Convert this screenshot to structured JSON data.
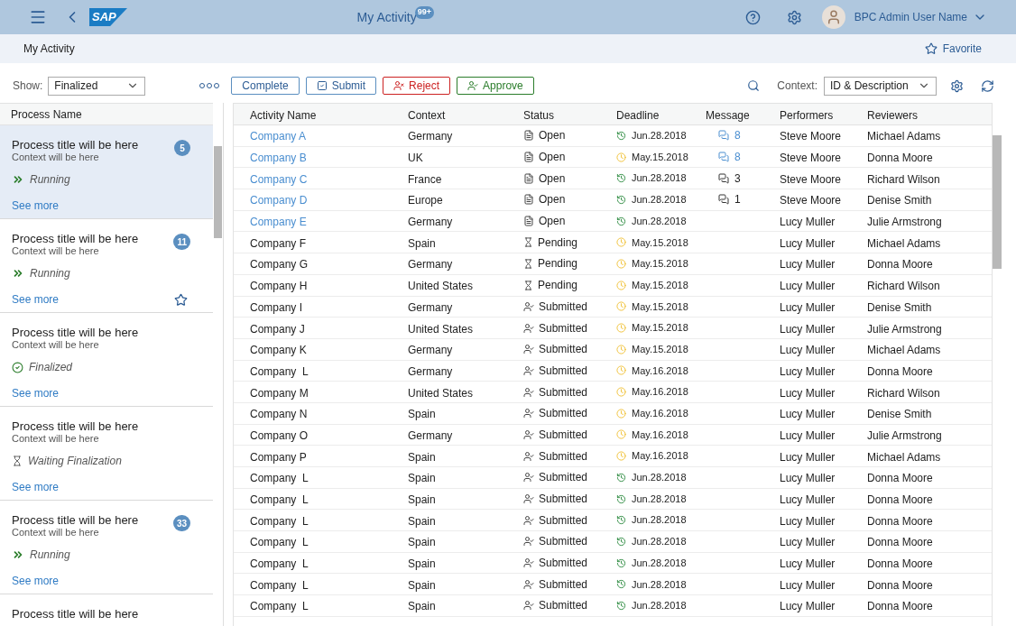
{
  "shell": {
    "logo": "SAP",
    "title": "My Activity",
    "badge": "99+",
    "user": "BPC Admin User Name"
  },
  "subheader": {
    "title": "My Activity",
    "favorite": "Favorite"
  },
  "toolbar": {
    "show_label": "Show:",
    "show_value": "Finalized",
    "buttons": [
      {
        "label": "Complete",
        "kind": "plain"
      },
      {
        "label": "Submit",
        "kind": "submit"
      },
      {
        "label": "Reject",
        "kind": "reject"
      },
      {
        "label": "Approve",
        "kind": "approve"
      }
    ],
    "context_label": "Context:",
    "context_value": "ID & Description"
  },
  "process_list": {
    "header": "Process Name",
    "items": [
      {
        "title": "Process title will be here",
        "context": "Context will be here",
        "status": "Running",
        "kind": "running",
        "count": "5",
        "selected": true,
        "favorite": false,
        "link": "See more"
      },
      {
        "title": "Process title will be here",
        "context": "Context will be here",
        "status": "Running",
        "kind": "running",
        "count": "11",
        "selected": false,
        "favorite": true,
        "link": "See more"
      },
      {
        "title": "Process title will be here",
        "context": "Context will be here",
        "status": "Finalized",
        "kind": "finalized",
        "selected": false,
        "favorite": false,
        "link": "See more"
      },
      {
        "title": "Process title will be here",
        "context": "Context will be here",
        "status": "Waiting Finalization",
        "kind": "waiting",
        "selected": false,
        "favorite": false,
        "link": "See more"
      },
      {
        "title": "Process title will be here",
        "context": "Context will be here",
        "status": "Running",
        "kind": "running",
        "count": "33",
        "selected": false,
        "favorite": false,
        "link": "See more"
      },
      {
        "title": "Process title will be here",
        "selected": false
      }
    ]
  },
  "table": {
    "columns": [
      "Activity Name",
      "Context",
      "Status",
      "Deadline",
      "Message",
      "Performers",
      "Reviewers"
    ],
    "rows": [
      {
        "name": "Company A",
        "link": true,
        "context": "Germany",
        "status": {
          "label": "Open",
          "kind": "open"
        },
        "deadline": {
          "date": "Jun.28.2018",
          "kind": "ontime"
        },
        "message": {
          "count": "8",
          "unread": true
        },
        "performer": "Steve Moore",
        "reviewer": "Michael Adams"
      },
      {
        "name": "Company B",
        "link": true,
        "context": "UK",
        "status": {
          "label": "Open",
          "kind": "open"
        },
        "deadline": {
          "date": "May.15.2018",
          "kind": "due"
        },
        "message": {
          "count": "8",
          "unread": true
        },
        "performer": "Steve Moore",
        "reviewer": "Donna Moore"
      },
      {
        "name": "Company C",
        "link": true,
        "context": "France",
        "status": {
          "label": "Open",
          "kind": "open"
        },
        "deadline": {
          "date": "Jun.28.2018",
          "kind": "ontime"
        },
        "message": {
          "count": "3",
          "unread": false
        },
        "performer": "Steve Moore",
        "reviewer": "Richard Wilson"
      },
      {
        "name": "Company D",
        "link": true,
        "context": "Europe",
        "status": {
          "label": "Open",
          "kind": "open"
        },
        "deadline": {
          "date": "Jun.28.2018",
          "kind": "ontime"
        },
        "message": {
          "count": "1",
          "unread": false
        },
        "performer": "Steve Moore",
        "reviewer": "Denise Smith"
      },
      {
        "name": "Company E",
        "link": true,
        "context": "Germany",
        "status": {
          "label": "Open",
          "kind": "open"
        },
        "deadline": {
          "date": "Jun.28.2018",
          "kind": "ontime"
        },
        "performer": "Lucy Muller",
        "reviewer": "Julie Armstrong"
      },
      {
        "name": "Company F",
        "link": false,
        "context": "Spain",
        "status": {
          "label": "Pending",
          "kind": "pending"
        },
        "deadline": {
          "date": "May.15.2018",
          "kind": "due"
        },
        "performer": "Lucy Muller",
        "reviewer": "Michael Adams"
      },
      {
        "name": "Company G",
        "link": false,
        "context": "Germany",
        "status": {
          "label": "Pending",
          "kind": "pending"
        },
        "deadline": {
          "date": "May.15.2018",
          "kind": "due"
        },
        "performer": "Lucy Muller",
        "reviewer": "Donna Moore"
      },
      {
        "name": "Company H",
        "link": false,
        "context": "United States",
        "status": {
          "label": "Pending",
          "kind": "pending"
        },
        "deadline": {
          "date": "May.15.2018",
          "kind": "due"
        },
        "performer": "Lucy Muller",
        "reviewer": "Richard Wilson"
      },
      {
        "name": "Company I",
        "link": false,
        "context": "Germany",
        "status": {
          "label": "Submitted",
          "kind": "submitted"
        },
        "deadline": {
          "date": "May.15.2018",
          "kind": "due"
        },
        "performer": "Lucy Muller",
        "reviewer": "Denise Smith"
      },
      {
        "name": "Company J",
        "link": false,
        "context": "United States",
        "status": {
          "label": "Submitted",
          "kind": "submitted"
        },
        "deadline": {
          "date": "May.15.2018",
          "kind": "due"
        },
        "performer": "Lucy Muller",
        "reviewer": "Julie Armstrong"
      },
      {
        "name": "Company K",
        "link": false,
        "context": "Germany",
        "status": {
          "label": "Submitted",
          "kind": "submitted"
        },
        "deadline": {
          "date": "May.15.2018",
          "kind": "due"
        },
        "performer": "Lucy Muller",
        "reviewer": "Michael Adams"
      },
      {
        "name": "Company  L",
        "link": false,
        "context": "Germany",
        "status": {
          "label": "Submitted",
          "kind": "submitted"
        },
        "deadline": {
          "date": "May.16.2018",
          "kind": "due"
        },
        "performer": "Lucy Muller",
        "reviewer": "Donna Moore"
      },
      {
        "name": "Company M",
        "link": false,
        "context": "United States",
        "status": {
          "label": "Submitted",
          "kind": "submitted"
        },
        "deadline": {
          "date": "May.16.2018",
          "kind": "due"
        },
        "performer": "Lucy Muller",
        "reviewer": "Richard Wilson"
      },
      {
        "name": "Company N",
        "link": false,
        "context": "Spain",
        "status": {
          "label": "Submitted",
          "kind": "submitted"
        },
        "deadline": {
          "date": "May.16.2018",
          "kind": "due"
        },
        "performer": "Lucy Muller",
        "reviewer": "Denise Smith"
      },
      {
        "name": "Company O",
        "link": false,
        "context": "Germany",
        "status": {
          "label": "Submitted",
          "kind": "submitted"
        },
        "deadline": {
          "date": "May.16.2018",
          "kind": "due"
        },
        "performer": "Lucy Muller",
        "reviewer": "Julie Armstrong"
      },
      {
        "name": "Company P",
        "link": false,
        "context": "Spain",
        "status": {
          "label": "Submitted",
          "kind": "submitted"
        },
        "deadline": {
          "date": "May.16.2018",
          "kind": "due"
        },
        "performer": "Lucy Muller",
        "reviewer": "Michael Adams"
      },
      {
        "name": "Company  L",
        "link": false,
        "context": "Spain",
        "status": {
          "label": "Submitted",
          "kind": "submitted"
        },
        "deadline": {
          "date": "Jun.28.2018",
          "kind": "ontime"
        },
        "performer": "Lucy Muller",
        "reviewer": "Donna Moore"
      },
      {
        "name": "Company  L",
        "link": false,
        "context": "Spain",
        "status": {
          "label": "Submitted",
          "kind": "submitted"
        },
        "deadline": {
          "date": "Jun.28.2018",
          "kind": "ontime"
        },
        "performer": "Lucy Muller",
        "reviewer": "Donna Moore"
      },
      {
        "name": "Company  L",
        "link": false,
        "context": "Spain",
        "status": {
          "label": "Submitted",
          "kind": "submitted"
        },
        "deadline": {
          "date": "Jun.28.2018",
          "kind": "ontime"
        },
        "performer": "Lucy Muller",
        "reviewer": "Donna Moore"
      },
      {
        "name": "Company  L",
        "link": false,
        "context": "Spain",
        "status": {
          "label": "Submitted",
          "kind": "submitted"
        },
        "deadline": {
          "date": "Jun.28.2018",
          "kind": "ontime"
        },
        "performer": "Lucy Muller",
        "reviewer": "Donna Moore"
      },
      {
        "name": "Company  L",
        "link": false,
        "context": "Spain",
        "status": {
          "label": "Submitted",
          "kind": "submitted"
        },
        "deadline": {
          "date": "Jun.28.2018",
          "kind": "ontime"
        },
        "performer": "Lucy Muller",
        "reviewer": "Donna Moore"
      },
      {
        "name": "Company  L",
        "link": false,
        "context": "Spain",
        "status": {
          "label": "Submitted",
          "kind": "submitted"
        },
        "deadline": {
          "date": "Jun.28.2018",
          "kind": "ontime"
        },
        "performer": "Lucy Muller",
        "reviewer": "Donna Moore"
      },
      {
        "name": "Company  L",
        "link": false,
        "context": "Spain",
        "status": {
          "label": "Submitted",
          "kind": "submitted"
        },
        "deadline": {
          "date": "Jun.28.2018",
          "kind": "ontime"
        },
        "performer": "Lucy Muller",
        "reviewer": "Donna Moore"
      }
    ]
  }
}
